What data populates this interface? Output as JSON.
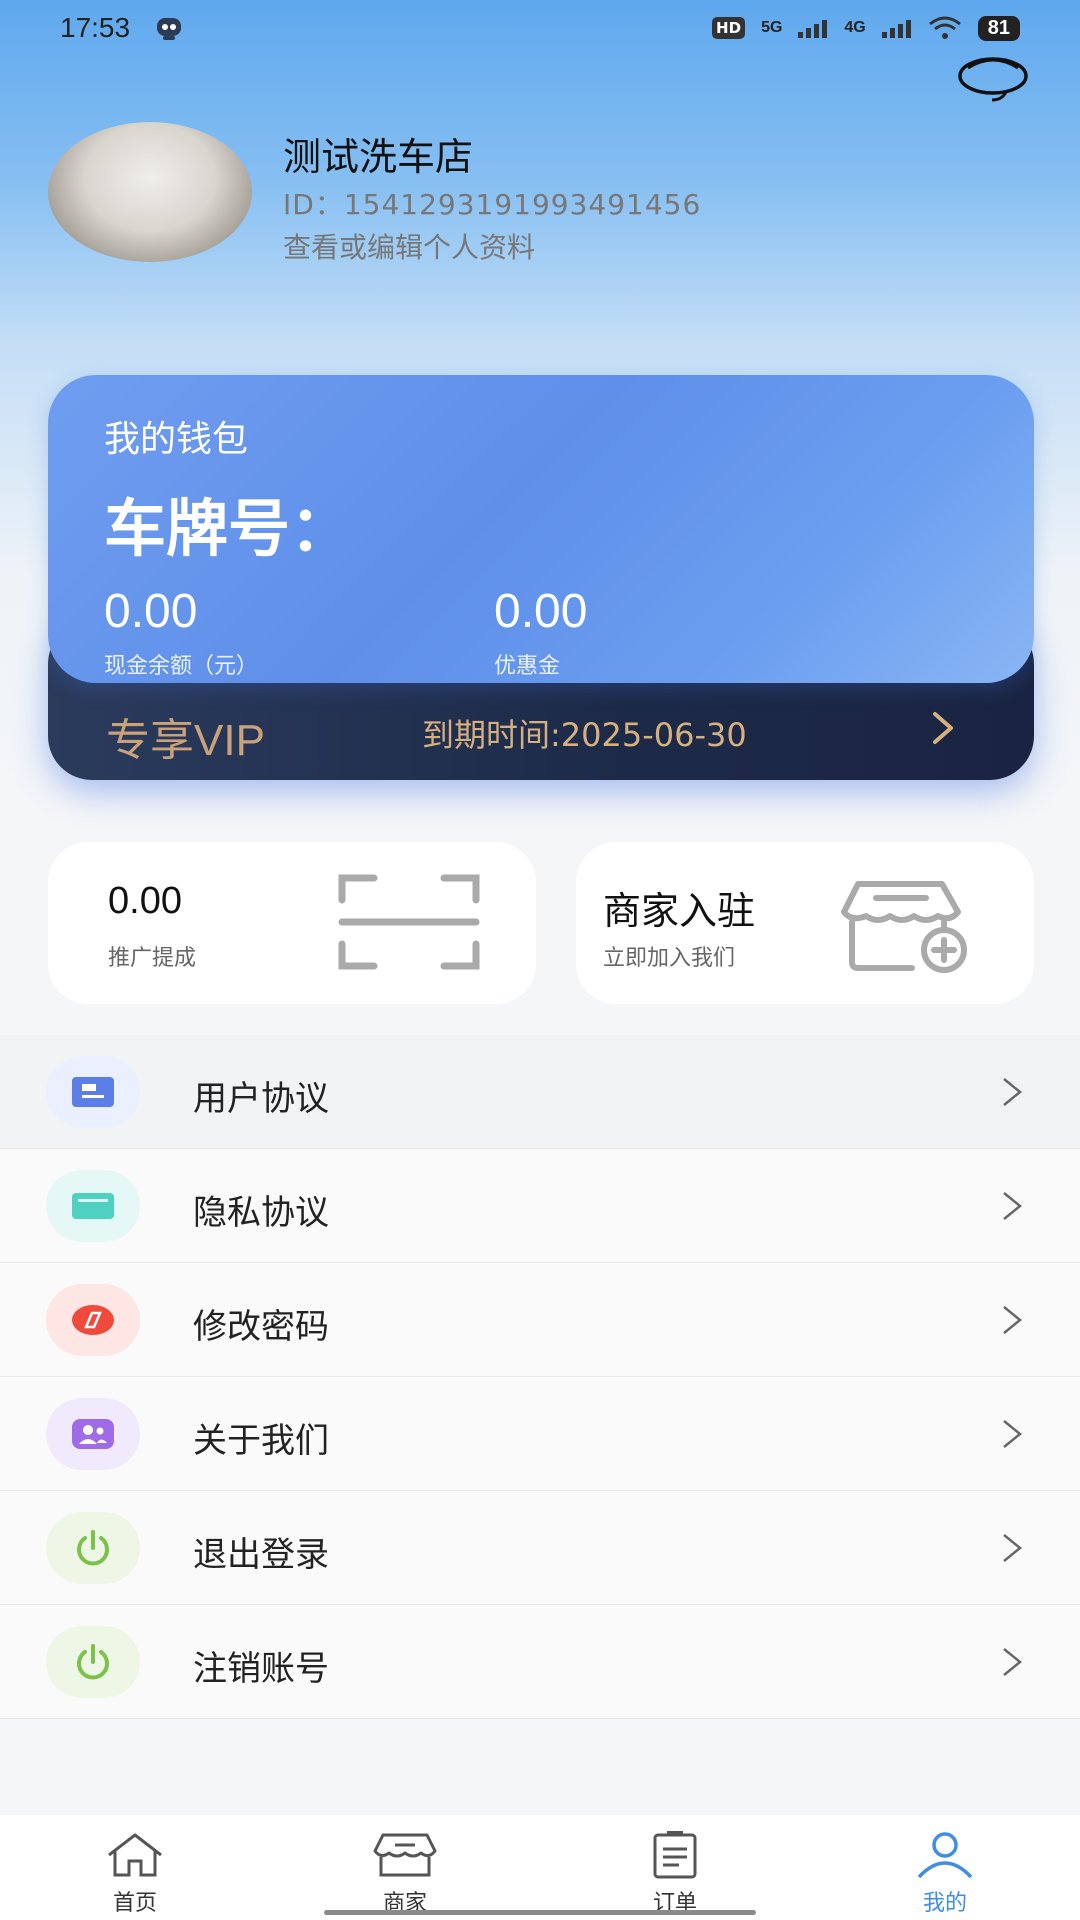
{
  "status_bar": {
    "time": "17:53",
    "network_hd": "HD",
    "network_5g": "5G",
    "network_4g": "4G",
    "battery": "81"
  },
  "profile": {
    "name": "测试洗车店",
    "id_line": "ID：1541293191993491456",
    "edit_link": "查看或编辑个人资料"
  },
  "wallet": {
    "title": "我的钱包",
    "plate_label": "车牌号：",
    "cash_balance": "0.00",
    "cash_balance_label": "现金余额（元）",
    "coupon_balance": "0.00",
    "coupon_balance_label": "优惠金"
  },
  "vip": {
    "title": "专享VIP",
    "expire_text": "到期时间:2025-06-30"
  },
  "promotion": {
    "value": "0.00",
    "label": "推广提成"
  },
  "merchant_join": {
    "title": "商家入驻",
    "subtitle": "立即加入我们"
  },
  "menu": [
    {
      "label": "用户协议",
      "icon": "document-icon",
      "color": "#5b7fe6",
      "bg": "#eaf0fd"
    },
    {
      "label": "隐私协议",
      "icon": "folder-icon",
      "color": "#4fd1c2",
      "bg": "#e6f8f6"
    },
    {
      "label": "修改密码",
      "icon": "compass-icon",
      "color": "#ee4b3c",
      "bg": "#fde6e3"
    },
    {
      "label": "关于我们",
      "icon": "group-icon",
      "color": "#a06be6",
      "bg": "#f1eafc"
    },
    {
      "label": "退出登录",
      "icon": "power-icon",
      "color": "#7cc24a",
      "bg": "#eef7e6"
    },
    {
      "label": "注销账号",
      "icon": "power-icon",
      "color": "#7cc24a",
      "bg": "#eef7e6"
    }
  ],
  "tabbar": [
    {
      "label": "首页",
      "icon": "home-icon"
    },
    {
      "label": "商家",
      "icon": "shop-icon"
    },
    {
      "label": "订单",
      "icon": "order-icon"
    },
    {
      "label": "我的",
      "icon": "user-icon",
      "active": true
    }
  ],
  "colors": {
    "accent": "#3f8ee0",
    "vip_gold": "#c9a27a",
    "wallet_blue": "#6f9df0"
  }
}
